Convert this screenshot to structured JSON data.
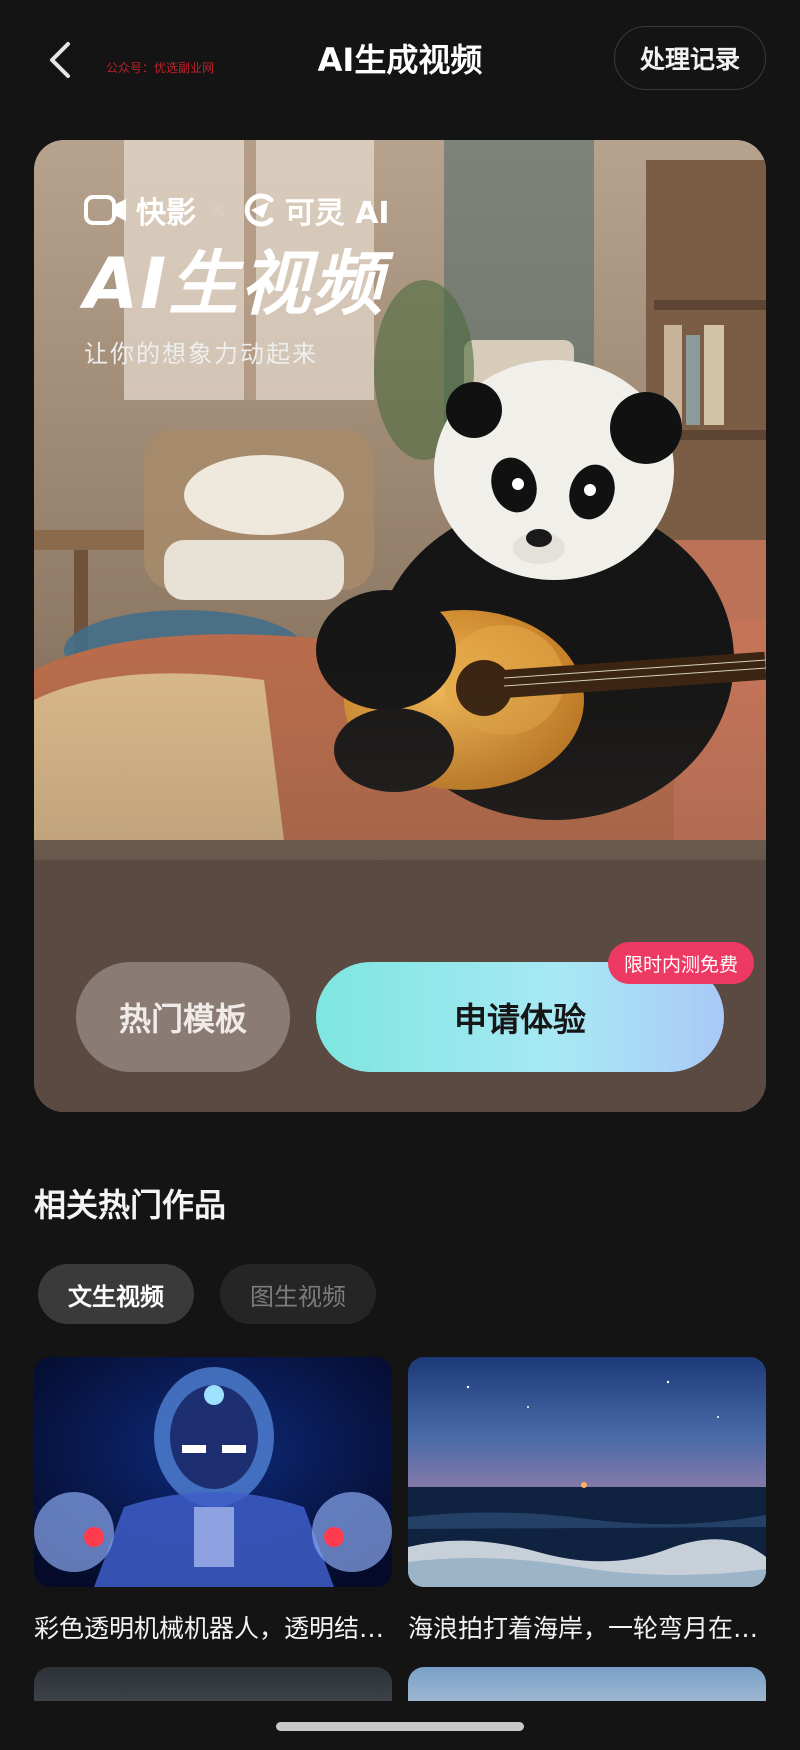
{
  "header": {
    "title": "AI生成视频",
    "watermark": "公众号：优选副业网",
    "history_label": "处理记录"
  },
  "hero": {
    "brand_kuaiying": "快影",
    "brand_separator": "×",
    "brand_kling": "可灵 AI",
    "title": "AI生视频",
    "subtitle": "让你的想象力动起来",
    "template_button": "热门模板",
    "apply_button": "申请体验",
    "badge": "限时内测免费"
  },
  "related": {
    "title": "相关热门作品",
    "tabs": [
      {
        "label": "文生视频",
        "active": true
      },
      {
        "label": "图生视频",
        "active": false
      }
    ],
    "cards": [
      {
        "caption": "彩色透明机械机器人，透明结构的机器人在蓝色背景下"
      },
      {
        "caption": "海浪拍打着海岸，一轮弯月在夜空中"
      }
    ]
  }
}
